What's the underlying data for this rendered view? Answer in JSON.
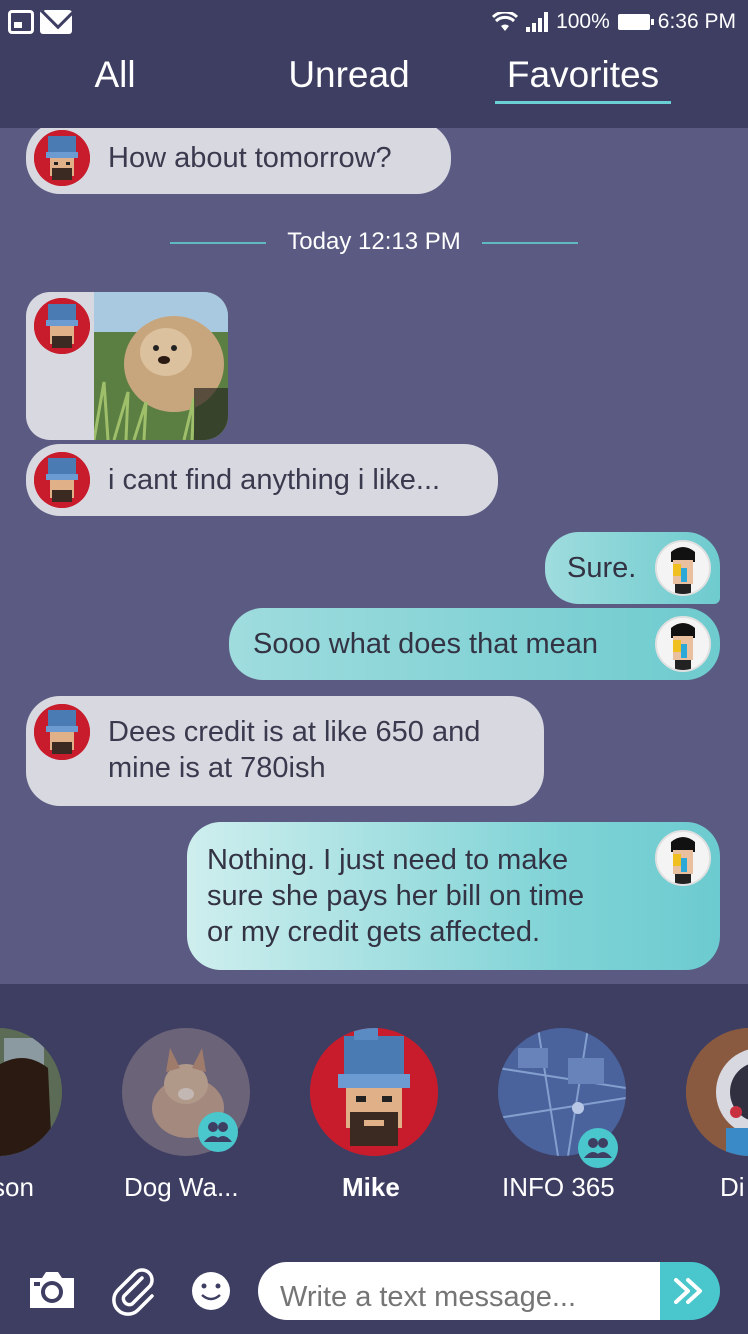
{
  "status_bar": {
    "battery": "100%",
    "time": "6:36 PM"
  },
  "tabs": [
    {
      "label": "All"
    },
    {
      "label": "Unread"
    },
    {
      "label": "Favorites",
      "active": true
    }
  ],
  "messages": [
    {
      "from": "Mike",
      "direction": "incoming",
      "text": "How about tomorrow?"
    },
    {
      "type": "timestamp",
      "text": "Today 12:13 PM"
    },
    {
      "from": "Mike",
      "direction": "incoming",
      "type": "photo",
      "subject": "fluffy dog in grass"
    },
    {
      "from": "Mike",
      "direction": "incoming",
      "text": "i cant find anything i like..."
    },
    {
      "from": "me",
      "direction": "outgoing",
      "text": "Sure."
    },
    {
      "from": "me",
      "direction": "outgoing",
      "text": "Sooo what does that mean"
    },
    {
      "from": "Mike",
      "direction": "incoming",
      "lines": [
        "Dees credit is at like 650 and",
        "mine is at 780ish"
      ]
    },
    {
      "from": "me",
      "direction": "outgoing",
      "lines": [
        "Nothing. I just need to make",
        "sure she pays her bill on time",
        "or my credit gets affected."
      ]
    }
  ],
  "contacts": [
    {
      "name": "son",
      "group": false
    },
    {
      "name": "Dog Wa...",
      "group": true
    },
    {
      "name": "Mike",
      "group": false,
      "selected": true
    },
    {
      "name": "INFO 365",
      "group": true
    },
    {
      "name": "Di",
      "group": false
    }
  ],
  "composer": {
    "placeholder": "Write a text message...",
    "icons": [
      "camera-icon",
      "paperclip-icon",
      "emoji-icon",
      "send-icon"
    ]
  },
  "colors": {
    "header": "#3e3e63",
    "chat_bg": "#5a5a82",
    "accent": "#49c7cc",
    "incoming_bubble": "#d8d8e0"
  }
}
